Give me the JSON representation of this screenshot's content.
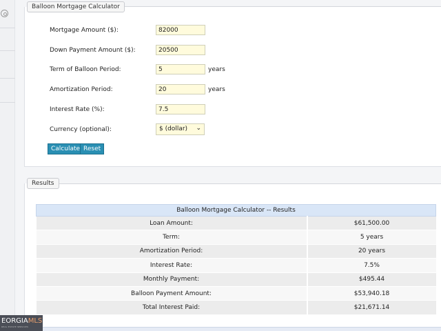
{
  "calculator": {
    "legend": "Balloon Mortgage Calculator",
    "fields": [
      {
        "label": "Mortgage Amount ($):",
        "value": "82000",
        "unit": ""
      },
      {
        "label": "Down Payment Amount ($):",
        "value": "20500",
        "unit": ""
      },
      {
        "label": "Term of Balloon Period:",
        "value": "5",
        "unit": "years"
      },
      {
        "label": "Amortization Period:",
        "value": "20",
        "unit": "years"
      },
      {
        "label": "Interest Rate (%):",
        "value": "7.5",
        "unit": ""
      }
    ],
    "currency": {
      "label": "Currency (optional):",
      "selected": "$ (dollar)"
    },
    "buttons": {
      "calculate": "Calculate",
      "reset": "Reset"
    }
  },
  "results": {
    "legend": "Results",
    "table_title": "Balloon Mortgage Calculator -- Results",
    "rows": [
      {
        "label": "Loan Amount:",
        "value": "$61,500.00"
      },
      {
        "label": "Term:",
        "value": "5 years"
      },
      {
        "label": "Amortization Period:",
        "value": "20 years"
      },
      {
        "label": "Interest Rate:",
        "value": "7.5%"
      },
      {
        "label": "Monthly Payment:",
        "value": "$495.44"
      },
      {
        "label": "Balloon Payment Amount:",
        "value": "$53,940.18"
      },
      {
        "label": "Total Interest Paid:",
        "value": "$21,671.14"
      }
    ]
  },
  "logo": {
    "text_main": "EORGIA",
    "text_accent": "MLS",
    "subtext": "REAL ESTATE SERVICES"
  }
}
